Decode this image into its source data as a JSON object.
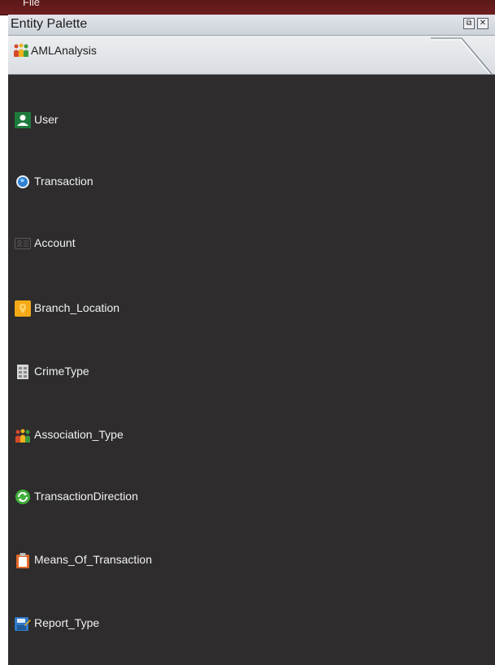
{
  "app": {
    "top_bar_text": "File",
    "panel_title": "Entity Palette",
    "restore_glyph": "⧉",
    "close_glyph": "✕"
  },
  "tab": {
    "label": "AMLAnalysis"
  },
  "entities": [
    {
      "label": "User",
      "icon": "user-icon"
    },
    {
      "label": "Transaction",
      "icon": "globe-icon"
    },
    {
      "label": "Account",
      "icon": "id-card-icon"
    },
    {
      "label": "Branch_Location",
      "icon": "map-pin-icon"
    },
    {
      "label": "CrimeType",
      "icon": "document-icon"
    },
    {
      "label": "Association_Type",
      "icon": "people-group-icon"
    },
    {
      "label": "TransactionDirection",
      "icon": "refresh-icon"
    },
    {
      "label": "Means_Of_Transaction",
      "icon": "clipboard-icon"
    },
    {
      "label": "Report_Type",
      "icon": "report-save-icon"
    }
  ],
  "colors": {
    "panel_background": "#2e2c2c",
    "top_bar": "#6d1f1f",
    "label_text": "#f2f2f2"
  }
}
